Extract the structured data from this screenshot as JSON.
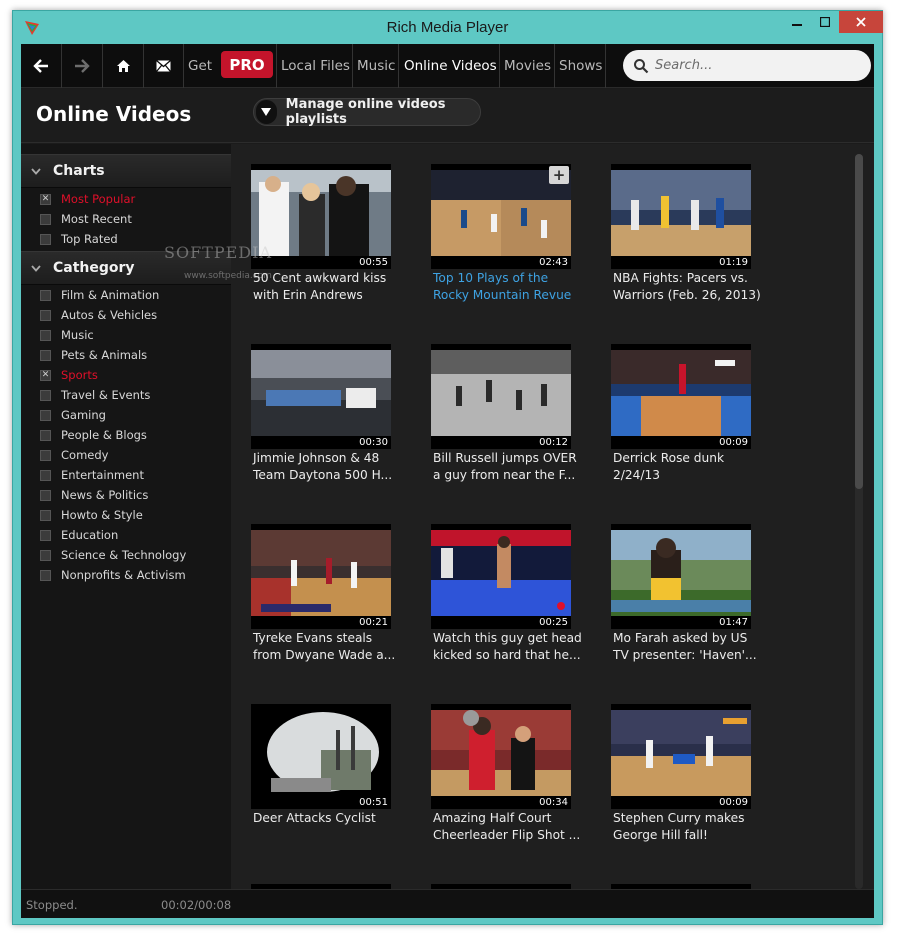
{
  "window": {
    "title": "Rich Media Player"
  },
  "toolbar": {
    "get_label": "Get",
    "pro_label": "PRO",
    "tabs": [
      {
        "label": "Local Files"
      },
      {
        "label": "Music"
      },
      {
        "label": "Online Videos",
        "active": true
      },
      {
        "label": "Movies"
      },
      {
        "label": "Shows"
      }
    ],
    "search_placeholder": "Search..."
  },
  "header": {
    "title": "Online Videos",
    "manage_label": "Manage online videos playlists"
  },
  "sidebar": {
    "charts_label": "Charts",
    "charts": [
      {
        "label": "Most Popular",
        "checked": true
      },
      {
        "label": "Most Recent",
        "checked": false
      },
      {
        "label": "Top Rated",
        "checked": false
      }
    ],
    "category_label": "Cathegory",
    "categories": [
      {
        "label": "Film & Animation",
        "checked": false
      },
      {
        "label": "Autos & Vehicles",
        "checked": false
      },
      {
        "label": "Music",
        "checked": false
      },
      {
        "label": "Pets & Animals",
        "checked": false
      },
      {
        "label": "Sports",
        "checked": true
      },
      {
        "label": "Travel & Events",
        "checked": false
      },
      {
        "label": "Gaming",
        "checked": false
      },
      {
        "label": "People & Blogs",
        "checked": false
      },
      {
        "label": "Comedy",
        "checked": false
      },
      {
        "label": "Entertainment",
        "checked": false
      },
      {
        "label": "News & Politics",
        "checked": false
      },
      {
        "label": "Howto & Style",
        "checked": false
      },
      {
        "label": "Education",
        "checked": false
      },
      {
        "label": "Science & Technology",
        "checked": false
      },
      {
        "label": "Nonprofits & Activism",
        "checked": false
      }
    ]
  },
  "videos": [
    {
      "title_line1": "50 Cent awkward kiss",
      "title_line2": "with Erin Andrews",
      "duration": "00:55"
    },
    {
      "title_line1": "Top 10 Plays of the",
      "title_line2": "Rocky Mountain Revue",
      "duration": "02:43",
      "hovered": true
    },
    {
      "title_line1": "NBA Fights: Pacers vs.",
      "title_line2": "Warriors (Feb. 26, 2013)",
      "duration": "01:19"
    },
    {
      "title_line1": "Jimmie Johnson & 48",
      "title_line2": "Team Daytona 500 H...",
      "duration": "00:30"
    },
    {
      "title_line1": "Bill Russell jumps OVER",
      "title_line2": "a guy from near the F...",
      "duration": "00:12"
    },
    {
      "title_line1": "Derrick Rose dunk",
      "title_line2": "2/24/13",
      "duration": "00:09"
    },
    {
      "title_line1": "Tyreke Evans steals",
      "title_line2": "from Dwyane Wade a...",
      "duration": "00:21"
    },
    {
      "title_line1": "Watch this guy get head",
      "title_line2": "kicked so hard that he...",
      "duration": "00:25"
    },
    {
      "title_line1": "Mo Farah asked by US",
      "title_line2": "TV presenter: 'Haven'...",
      "duration": "01:47"
    },
    {
      "title_line1": "Deer Attacks Cyclist",
      "title_line2": "",
      "duration": "00:51"
    },
    {
      "title_line1": "Amazing Half Court",
      "title_line2": "Cheerleader Flip Shot ...",
      "duration": "00:34"
    },
    {
      "title_line1": "Stephen Curry makes",
      "title_line2": "George Hill fall!",
      "duration": "00:09"
    }
  ],
  "status": {
    "state": "Stopped.",
    "time": "00:02/00:08"
  },
  "watermark": {
    "text": "SOFTPEDIA",
    "url": "www.softpedia.com"
  },
  "colors": {
    "accent_red": "#c4142b",
    "frame": "#5ec8c4",
    "link_blue": "#3ea2e2"
  }
}
